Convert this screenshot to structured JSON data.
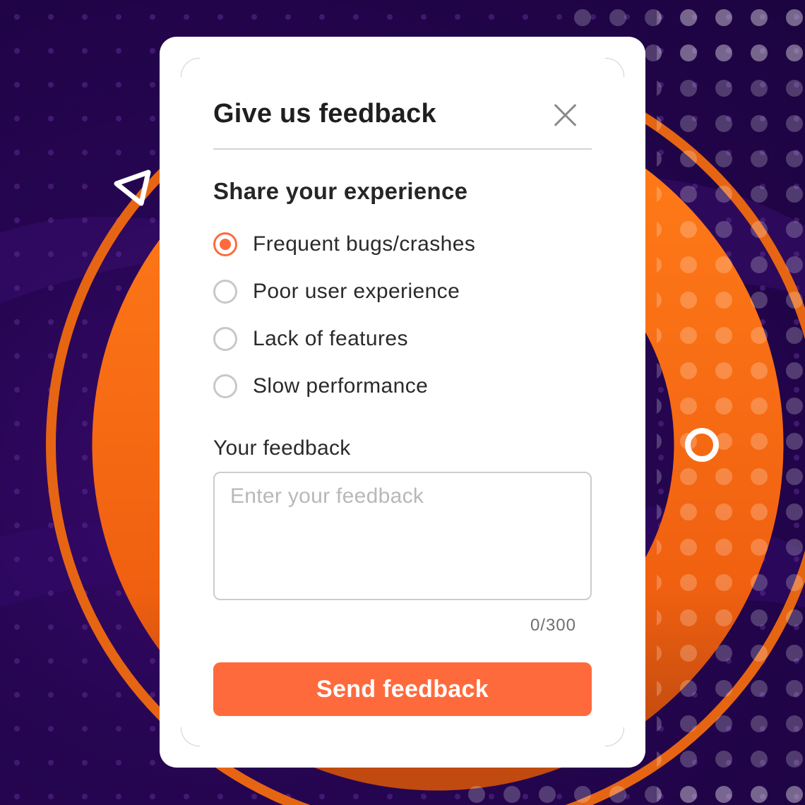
{
  "dialog": {
    "title": "Give us feedback",
    "section_title": "Share your experience",
    "options": [
      {
        "label": "Frequent bugs/crashes",
        "checked": true
      },
      {
        "label": "Poor user experience",
        "checked": false
      },
      {
        "label": "Lack of features",
        "checked": false
      },
      {
        "label": "Slow performance",
        "checked": false
      }
    ],
    "feedback_label": "Your feedback",
    "feedback_placeholder": "Enter your feedback",
    "feedback_value": "",
    "counter": "0/300",
    "send_label": "Send feedback"
  },
  "icons": {
    "close": "close-icon",
    "triangle": "triangle-outline-icon",
    "ring": "ring-outline-icon"
  },
  "colors": {
    "accent": "#ff6a3d",
    "background_purple": "#260552",
    "ring_orange": "#f06a10"
  }
}
